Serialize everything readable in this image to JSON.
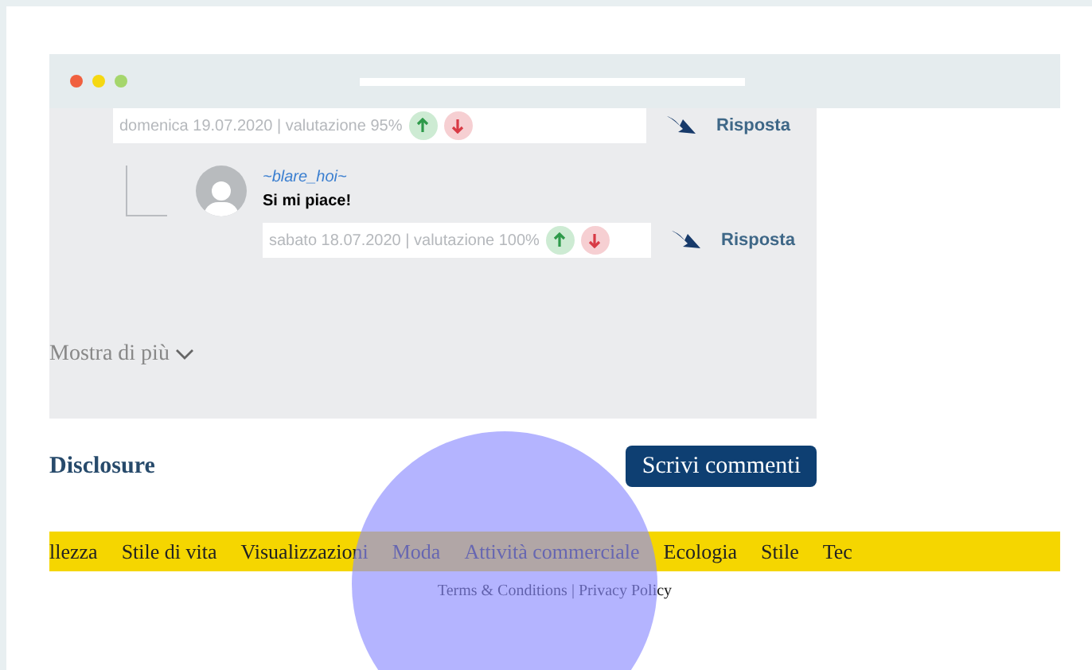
{
  "comments": [
    {
      "meta": "domenica 19.07.2020 | valutazione 95%",
      "reply": "Risposta"
    },
    {
      "author": "~blare_hoi~",
      "text": "Si mi piace!",
      "meta": "sabato 18.07.2020 | valutazione 100%",
      "reply": "Risposta"
    }
  ],
  "show_more": "Mostra di più",
  "disclosure": "Disclosure",
  "write_button": "Scrivi commenti",
  "nav": [
    "llezza",
    "Stile di vita",
    "Visualizzazioni",
    "Moda",
    "Attività commerciale",
    "Ecologia",
    "Stile",
    "Tec"
  ],
  "footer": "Terms & Conditions | Privacy Policy"
}
